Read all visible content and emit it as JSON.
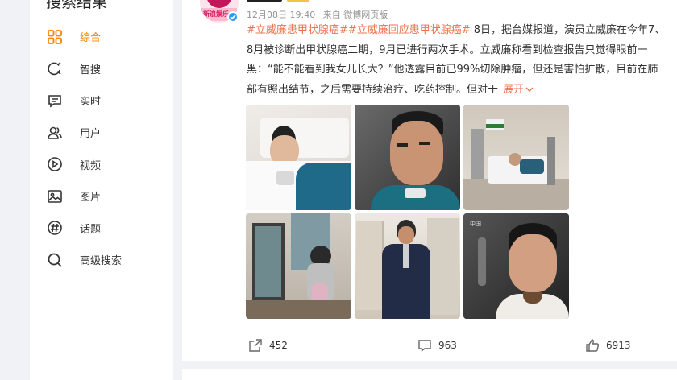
{
  "sidebar": {
    "title": "搜索结果",
    "items": [
      {
        "label": "综合",
        "icon": "grid-icon",
        "active": true
      },
      {
        "label": "智搜",
        "icon": "smart-search-icon"
      },
      {
        "label": "实时",
        "icon": "realtime-icon"
      },
      {
        "label": "用户",
        "icon": "users-icon"
      },
      {
        "label": "视频",
        "icon": "video-play-icon"
      },
      {
        "label": "图片",
        "icon": "image-icon"
      },
      {
        "label": "话题",
        "icon": "hashtag-icon"
      },
      {
        "label": "高级搜索",
        "icon": "search-icon"
      }
    ],
    "active_color": "#ff8200"
  },
  "post": {
    "date": "12月08日 19:40",
    "source": "来自 微博网页版",
    "tag1": "#立威廉患甲状腺癌#",
    "tag2": "#立威廉回应患甲状腺癌#",
    "body": " 8日，据台媒报道，演员立威廉在今年7、8月被诊断出甲状腺癌二期，9月已进行两次手术。立威廉称看到检查报告只觉得眼前一黑：“能不能看到我女儿长大？”他透露目前已99%切除肿瘤，但还是害怕扩散，目前在肺部有照出结节，之后需要持续治疗、吃药控制。但对于",
    "expand_label": "展开",
    "tag_color": "#eb7350",
    "actions": {
      "repost_count": "452",
      "comment_count": "963",
      "like_count": "6913"
    }
  }
}
